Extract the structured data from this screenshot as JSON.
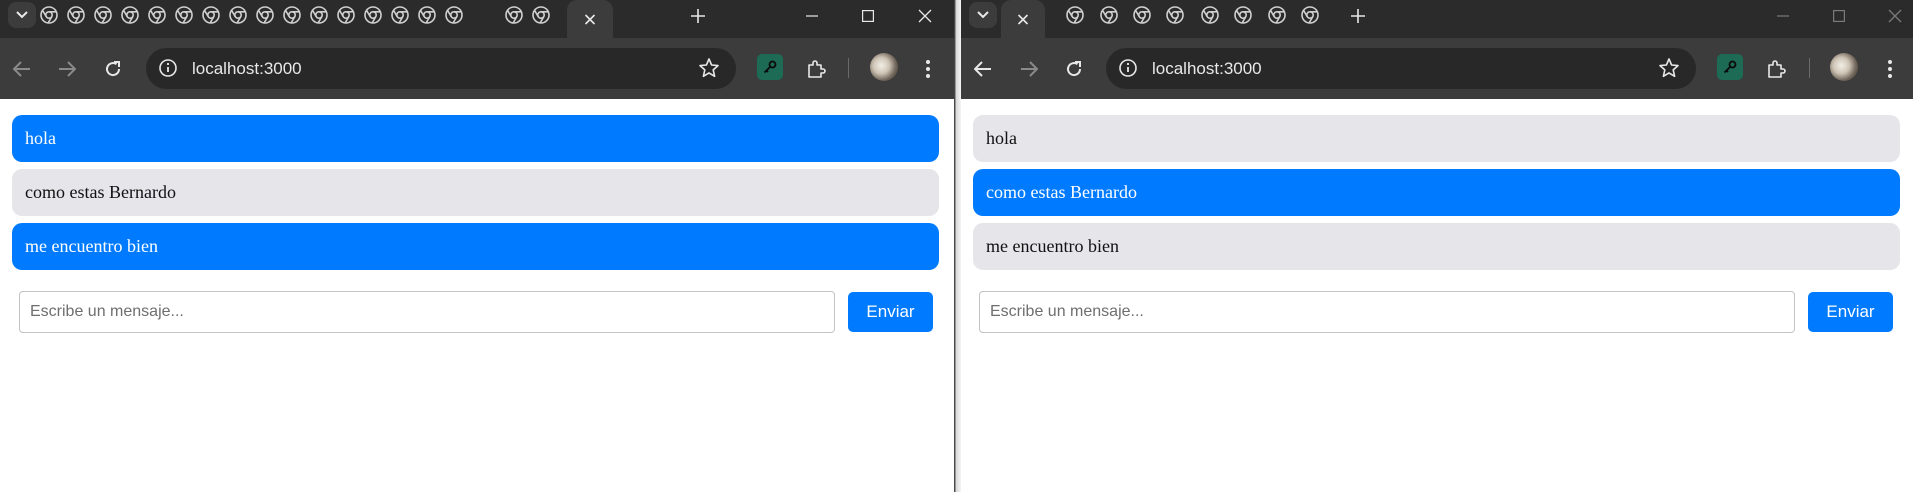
{
  "browser": {
    "url": "localhost:3000"
  },
  "windows": [
    {
      "chat": {
        "messages": [
          {
            "text": "hola",
            "kind": "sent"
          },
          {
            "text": "como estas Bernardo",
            "kind": "received"
          },
          {
            "text": "me encuentro bien",
            "kind": "sent"
          }
        ],
        "input_placeholder": "Escribe un mensaje...",
        "send_label": "Enviar"
      }
    },
    {
      "chat": {
        "messages": [
          {
            "text": "hola",
            "kind": "received"
          },
          {
            "text": "como estas Bernardo",
            "kind": "sent"
          },
          {
            "text": "me encuentro bien",
            "kind": "received"
          }
        ],
        "input_placeholder": "Escribe un mensaje...",
        "send_label": "Enviar"
      }
    }
  ],
  "colors": {
    "sent_bubble": "#007bff",
    "received_bubble": "#e5e5ea",
    "browser_frame": "#3c3c3c",
    "tab_strip": "#2b2b2b"
  },
  "icons": {
    "tab_favicon": "chrome-globe-icon",
    "tab_search": "chevron-down-icon",
    "new_tab": "plus-icon",
    "back": "arrow-left-icon",
    "forward": "arrow-right-icon",
    "reload": "reload-icon",
    "site_info": "info-icon",
    "bookmark": "star-icon",
    "extension": "key-extension-icon",
    "extensions_menu": "puzzle-icon",
    "menu": "kebab-menu-icon"
  }
}
